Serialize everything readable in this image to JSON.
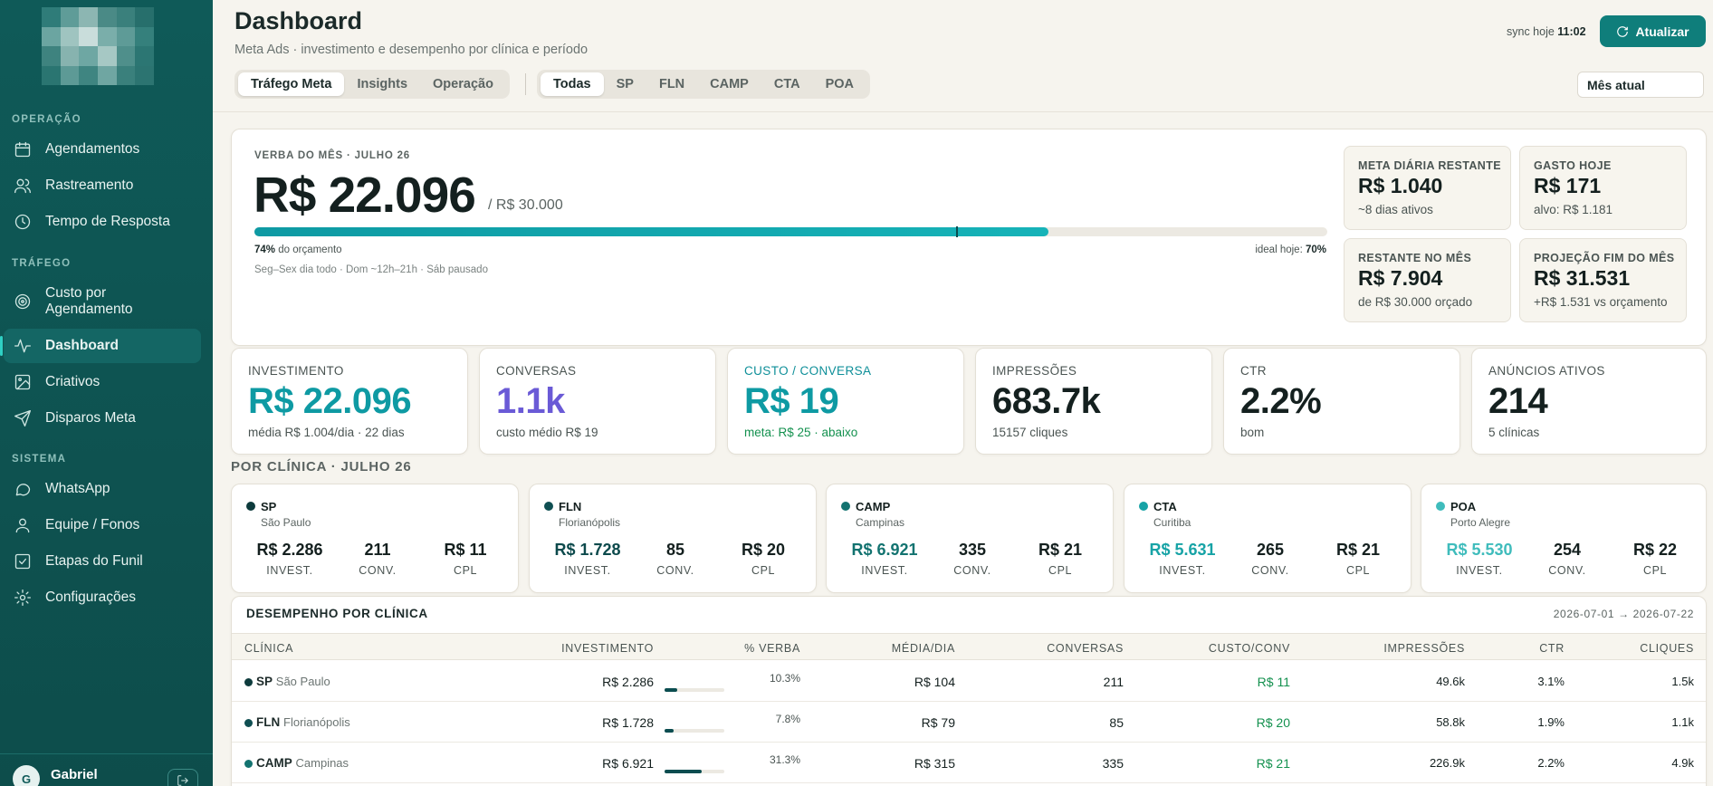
{
  "sidebar": {
    "logo_cells": [
      "#2f7c79",
      "#5f9c98",
      "#8cb6b2",
      "#4a8a86",
      "#3a807c",
      "#276f6c",
      "#6ba5a1",
      "#9fc4c0",
      "#c9dddb",
      "#7aaeaa",
      "#5e9b97",
      "#35807c",
      "#3e837f",
      "#87b3af",
      "#6ea7a3",
      "#a6c8c4",
      "#4f8f8b",
      "#2c7673",
      "#2a7571",
      "#5d9a96",
      "#3f8581",
      "#6fa6a2",
      "#3a807c",
      "#2c7471"
    ],
    "sections": [
      {
        "label": "OPERAÇÃO"
      },
      {
        "label": "TRÁFEGO"
      },
      {
        "label": "SISTEMA"
      }
    ],
    "items": [
      {
        "label": "Agendamentos",
        "icon": "calendar-icon"
      },
      {
        "label": "Rastreamento",
        "icon": "users-icon"
      },
      {
        "label": "Tempo de Resposta",
        "icon": "clock-icon"
      },
      {
        "label": "Custo por Agendamento",
        "icon": "target-icon"
      },
      {
        "label": "Dashboard",
        "icon": "activity-icon"
      },
      {
        "label": "Criativos",
        "icon": "image-icon"
      },
      {
        "label": "Disparos Meta",
        "icon": "send-icon"
      },
      {
        "label": "WhatsApp",
        "icon": "message-icon"
      },
      {
        "label": "Equipe / Fonos",
        "icon": "user-icon"
      },
      {
        "label": "Etapas do Funil",
        "icon": "checklist-icon"
      },
      {
        "label": "Configurações",
        "icon": "gear-icon"
      }
    ],
    "user": {
      "initial": "G",
      "name": "Gabriel"
    }
  },
  "header": {
    "title": "Dashboard",
    "subtitle": "Meta Ads · investimento e desempenho por clínica e período",
    "sync_label": "sync hoje",
    "sync_time": "11:02",
    "refresh_label": "Atualizar",
    "view_tabs": [
      {
        "label": "Tráfego Meta",
        "active": true
      },
      {
        "label": "Insights",
        "active": false
      },
      {
        "label": "Operação",
        "active": false
      }
    ],
    "clinic_tabs": [
      {
        "label": "Todas",
        "active": true
      },
      {
        "label": "SP",
        "active": false
      },
      {
        "label": "FLN",
        "active": false
      },
      {
        "label": "CAMP",
        "active": false
      },
      {
        "label": "CTA",
        "active": false
      },
      {
        "label": "POA",
        "active": false
      }
    ],
    "period": "Mês atual"
  },
  "budget": {
    "label": "VERBA DO MÊS · JULHO 26",
    "value": "R$ 22.096",
    "total": "/ R$ 30.000",
    "progress": 0.74,
    "ideal": 0.7,
    "pct_value": "74%",
    "pct_label": "do orçamento",
    "ideal_label": "ideal hoje:",
    "ideal_value": "70%",
    "schedule": "Seg–Sex dia todo · Dom ~12h–21h · Sáb pausado",
    "minis": [
      {
        "label": "META DIÁRIA RESTANTE",
        "value": "R$ 1.040",
        "sub": "~8 dias ativos"
      },
      {
        "label": "GASTO HOJE",
        "value": "R$ 171",
        "sub": "alvo: R$ 1.181"
      },
      {
        "label": "RESTANTE NO MÊS",
        "value": "R$ 7.904",
        "sub": "de R$ 30.000 orçado"
      },
      {
        "label": "PROJEÇÃO FIM DO MÊS",
        "value": "R$ 31.531",
        "sub": "+R$ 1.531 vs orçamento"
      }
    ]
  },
  "kpis": [
    {
      "label": "INVESTIMENTO",
      "value": "R$ 22.096",
      "sub": "média R$ 1.004/dia · 22 dias",
      "color": "#0e9aa3",
      "label_color": "#4a5452",
      "sub_color": "#4a5452"
    },
    {
      "label": "CONVERSAS",
      "value": "1.1k",
      "sub": "custo médio R$ 19",
      "color": "#6a5ad6",
      "label_color": "#4a5452",
      "sub_color": "#4a5452"
    },
    {
      "label": "CUSTO / CONVERSA",
      "value": "R$ 19",
      "sub": "meta: R$ 25 · abaixo",
      "color": "#0e9aa3",
      "label_color": "#0e8f99",
      "sub_color": "#14914f"
    },
    {
      "label": "IMPRESSÕES",
      "value": "683.7k",
      "sub": "15157 cliques",
      "color": "#14201f",
      "label_color": "#4a5452",
      "sub_color": "#4a5452"
    },
    {
      "label": "CTR",
      "value": "2.2%",
      "sub": "bom",
      "color": "#14201f",
      "label_color": "#4a5452",
      "sub_color": "#4a5452"
    },
    {
      "label": "ANÚNCIOS ATIVOS",
      "value": "214",
      "sub": "5 clínicas",
      "color": "#14201f",
      "label_color": "#4a5452",
      "sub_color": "#4a5452"
    }
  ],
  "clinics_title": "POR CLÍNICA · JULHO 26",
  "clinics": [
    {
      "code": "SP",
      "name": "São Paulo",
      "dot": "#0d3b3c",
      "invest": "R$ 2.286",
      "invest_color": "#14201f",
      "conv": "211",
      "cpl": "R$ 11"
    },
    {
      "code": "FLN",
      "name": "Florianópolis",
      "dot": "#0f4f52",
      "invest": "R$ 1.728",
      "invest_color": "#0d4a4c",
      "conv": "85",
      "cpl": "R$ 20"
    },
    {
      "code": "CAMP",
      "name": "Campinas",
      "dot": "#137370",
      "invest": "R$ 6.921",
      "invest_color": "#137370",
      "conv": "335",
      "cpl": "R$ 21"
    },
    {
      "code": "CTA",
      "name": "Curitiba",
      "dot": "#17a3a6",
      "invest": "R$ 5.631",
      "invest_color": "#17a3a6",
      "conv": "265",
      "cpl": "R$ 21"
    },
    {
      "code": "POA",
      "name": "Porto Alegre",
      "dot": "#3fbcbc",
      "invest": "R$ 5.530",
      "invest_color": "#3fbcbc",
      "conv": "254",
      "cpl": "R$ 22"
    }
  ],
  "clinic_col_labels": {
    "invest": "INVEST.",
    "conv": "CONV.",
    "cpl": "CPL"
  },
  "table": {
    "title": "DESEMPENHO POR CLÍNICA",
    "range": "2026-07-01 → 2026-07-22",
    "headers": [
      "CLÍNICA",
      "INVESTIMENTO",
      "% VERBA",
      "MÉDIA/DIA",
      "CONVERSAS",
      "CUSTO/CONV",
      "IMPRESSÕES",
      "CTR",
      "CLIQUES"
    ],
    "rows": [
      {
        "code": "SP",
        "name": "São Paulo",
        "dot": "#0d3b3c",
        "invest": "R$ 2.286",
        "pct": "10.3%",
        "pct_value": 0.103,
        "daily": "R$ 104",
        "conv": "211",
        "cost": "R$ 11",
        "impr": "49.6k",
        "ctr": "3.1%",
        "clicks": "1.5k"
      },
      {
        "code": "FLN",
        "name": "Florianópolis",
        "dot": "#0f4f52",
        "invest": "R$ 1.728",
        "pct": "7.8%",
        "pct_value": 0.078,
        "daily": "R$ 79",
        "conv": "85",
        "cost": "R$ 20",
        "impr": "58.8k",
        "ctr": "1.9%",
        "clicks": "1.1k"
      },
      {
        "code": "CAMP",
        "name": "Campinas",
        "dot": "#137370",
        "invest": "R$ 6.921",
        "pct": "31.3%",
        "pct_value": 0.313,
        "daily": "R$ 315",
        "conv": "335",
        "cost": "R$ 21",
        "impr": "226.9k",
        "ctr": "2.2%",
        "clicks": "4.9k"
      }
    ]
  }
}
